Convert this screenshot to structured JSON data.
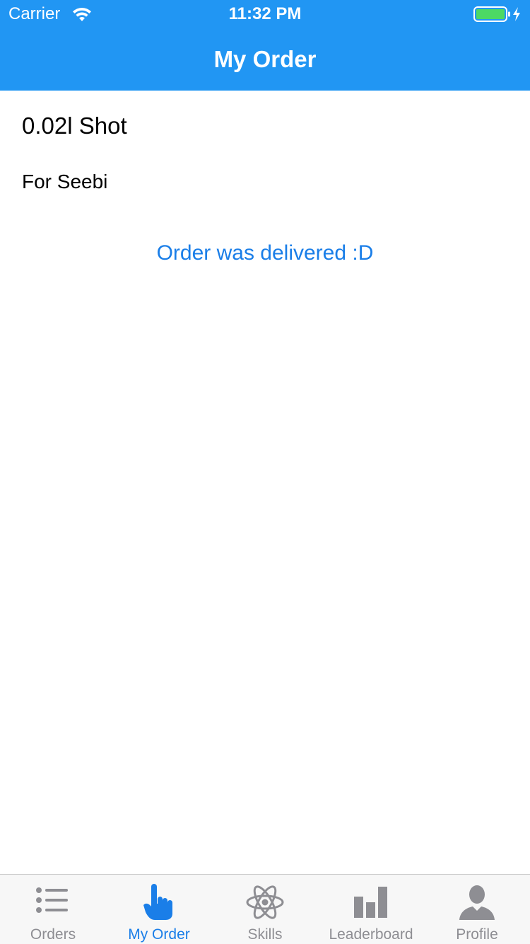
{
  "status_bar": {
    "carrier": "Carrier",
    "time": "11:32 PM"
  },
  "nav": {
    "title": "My Order"
  },
  "order": {
    "item": "0.02l Shot",
    "recipient": "For Seebi",
    "status": "Order was delivered :D"
  },
  "tabs": [
    {
      "label": "Orders",
      "icon": "list-icon",
      "active": false
    },
    {
      "label": "My Order",
      "icon": "pointing-hand-icon",
      "active": true
    },
    {
      "label": "Skills",
      "icon": "atom-icon",
      "active": false
    },
    {
      "label": "Leaderboard",
      "icon": "bar-chart-icon",
      "active": false
    },
    {
      "label": "Profile",
      "icon": "person-icon",
      "active": false
    }
  ],
  "colors": {
    "nav_bar": "#2196f3",
    "accent": "#1a7ee8",
    "inactive_tab": "#8e8e93",
    "battery": "#4cd964"
  }
}
